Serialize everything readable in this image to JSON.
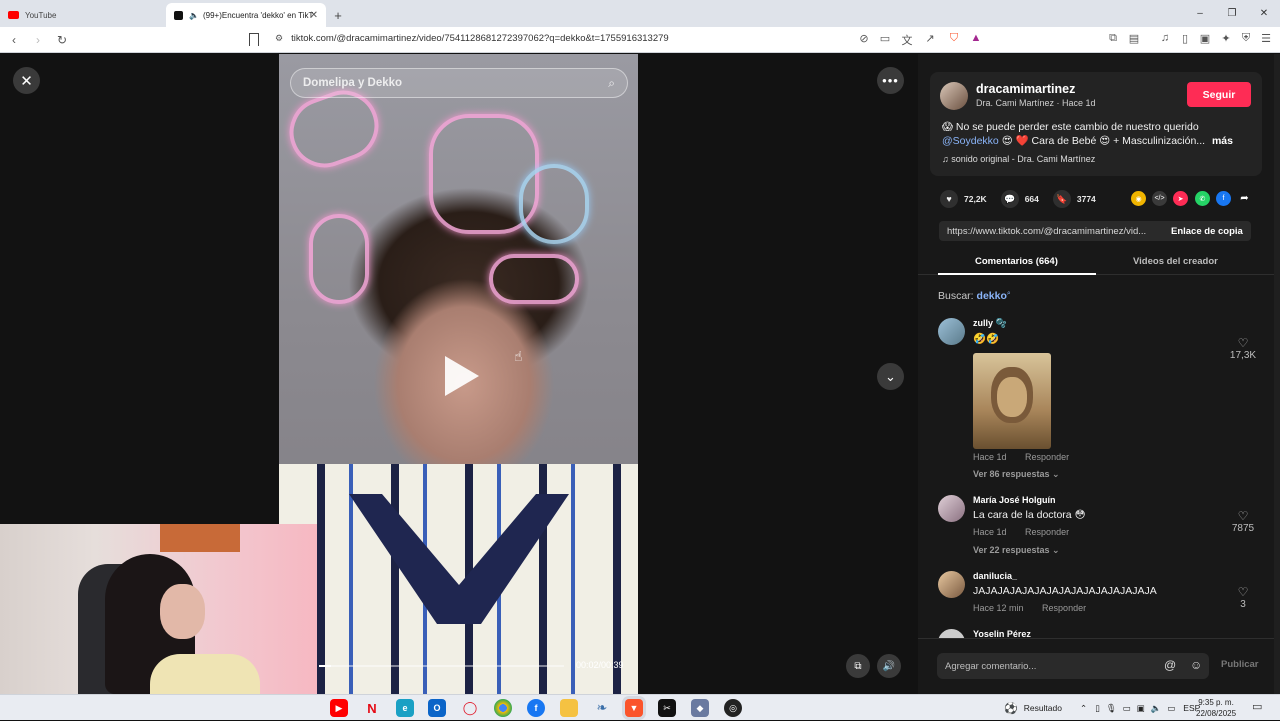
{
  "browser": {
    "tabs": [
      {
        "label": "YouTube",
        "favicon_color": "#ff0000"
      },
      {
        "label": "(99+)Encuentra 'dekko' en TikTok",
        "favicon_color": "#111111"
      }
    ],
    "new_tab": "+",
    "url": "tiktok.com/@dracamimartinez/video/7541128681272397062?q=dekko&t=1755916313279",
    "window_controls": [
      "–",
      "❐",
      "✕"
    ]
  },
  "video": {
    "search_placeholder": "Domelipa y Dekko",
    "time": "00:02/00:39",
    "progress": 0.05
  },
  "post": {
    "username": "dracamimartinez",
    "subline": "Dra. Cami Martínez · Hace 1d",
    "follow_label": "Seguir",
    "caption_start": "😱 No se puede perder este cambio de nuestro querido",
    "caption_mention": "@Soydekko",
    "caption_end": " 😍 ❤️  Cara de Bebé 😍 + Masculinización...",
    "more_label": "más",
    "sound": "♫  sonido original - Dra. Cami Martínez",
    "likes": "72,2K",
    "comments": "664",
    "saves": "3774",
    "link": "https://www.tiktok.com/@dracamimartinez/vid...",
    "copy_label": "Enlace de copia"
  },
  "panel_tabs": {
    "comments": "Comentarios (664)",
    "creator": "Videos del creador"
  },
  "search_line": {
    "label": "Buscar:",
    "keyword": "dekko"
  },
  "comments": [
    {
      "name": "zully 🫧",
      "text": "🤣🤣",
      "time": "Hace 1d",
      "reply": "Responder",
      "replies": "Ver 86 respuestas ⌄",
      "likes": "17,3K"
    },
    {
      "name": "María José Holguín",
      "text": "La cara de la doctora 😳",
      "time": "Hace 1d",
      "reply": "Responder",
      "replies": "Ver 22 respuestas ⌄",
      "likes": "7875"
    },
    {
      "name": "danilucia_",
      "text": "JAJAJAJAJAJAJAJAJAJAJAJAJAJAJA",
      "time": "Hace 12 min",
      "reply": "Responder",
      "likes": "3"
    },
    {
      "name": "Yoselin Pérez"
    }
  ],
  "composer": {
    "placeholder": "Agregar comentario...",
    "post_label": "Publicar"
  },
  "taskbar": {
    "weather": "Resultado",
    "lang": "ESP",
    "time": "9:35 p. m.",
    "date": "22/08/2025"
  }
}
